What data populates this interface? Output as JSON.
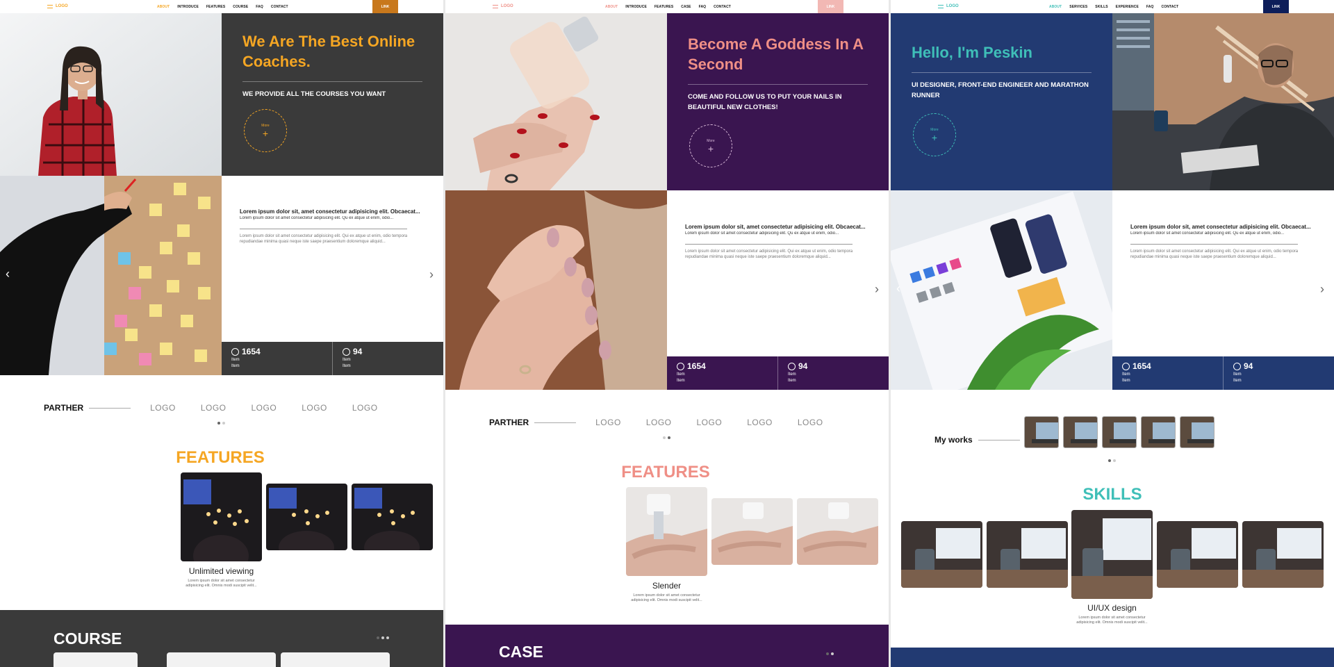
{
  "themes": [
    {
      "accent": "#f5a623",
      "dark": "#3a3a3a",
      "nav": {
        "logo": "LOGO",
        "items": [
          "ABOUT",
          "INTRODUCE",
          "FEATURES",
          "COURSE",
          "FAQ",
          "CONTACT"
        ],
        "link": "LINK"
      },
      "hero": {
        "title": "We Are The Best Online Coaches.",
        "subtitle": "WE PROVIDE ALL THE COURSES YOU WANT",
        "more": "More"
      },
      "text": {
        "title": "Lorem ipsum dolor sit, amet consectetur adipisicing elit. Obcaecat...",
        "line2": "Lorem ipsum dolor sit amet consectetur adipisicing elit. Qu ex atque ut enim, odio...",
        "body": "Lorem ipsum dolor sit amet consectetur adipisicing elit. Qui ex atque ut enim, odio tempora repudiandae minima quasi neque iste saepe praesentium doloremque aliquid..."
      },
      "stats": [
        {
          "num": "1654",
          "l1": "Item",
          "l2": "Item"
        },
        {
          "num": "94",
          "l1": "Item",
          "l2": "Item"
        }
      ],
      "partner": {
        "title": "PARTHER",
        "logos": [
          "LOGO",
          "LOGO",
          "LOGO",
          "LOGO",
          "LOGO"
        ]
      },
      "section": "FEATURES",
      "card": {
        "name": "Unlimited viewing",
        "desc": "Lorem ipsum dolor sit amet consectetur adipisicing elit. Omnis modi suscipit velit..."
      },
      "bottom": "COURSE"
    },
    {
      "accent": "#ef8f86",
      "dark": "#3a1550",
      "nav": {
        "logo": "LOGO",
        "items": [
          "ABOUT",
          "INTRODUCE",
          "FEATURES",
          "CASE",
          "FAQ",
          "CONTACT"
        ],
        "link": "LINK"
      },
      "hero": {
        "title": "Become A Goddess In A Second",
        "subtitle": "COME AND FOLLOW US TO PUT YOUR NAILS IN BEAUTIFUL NEW CLOTHES!",
        "more": "More"
      },
      "text": {
        "title": "Lorem ipsum dolor sit, amet consectetur adipisicing elit. Obcaecat...",
        "line2": "Lorem ipsum dolor sit amet consectetur adipisicing elit. Qu ex atque ut enim, odio...",
        "body": "Lorem ipsum dolor sit amet consectetur adipisicing elit. Qui ex atque ut enim, odio tempora repudiandae minima quasi neque iste saepe praesentium doloremque aliquid..."
      },
      "stats": [
        {
          "num": "1654",
          "l1": "Item",
          "l2": "Item"
        },
        {
          "num": "94",
          "l1": "Item",
          "l2": "Item"
        }
      ],
      "partner": {
        "title": "PARTHER",
        "logos": [
          "LOGO",
          "LOGO",
          "LOGO",
          "LOGO",
          "LOGO"
        ]
      },
      "section": "FEATURES",
      "card": {
        "name": "Slender",
        "desc": "Lorem ipsum dolor sit amet consectetur adipisicing elit. Omnis modi suscipit velit..."
      },
      "bottom": "CASE"
    },
    {
      "accent": "#3fbfb8",
      "dark": "#223a72",
      "nav": {
        "logo": "LOGO",
        "items": [
          "ABOUT",
          "SERVICES",
          "SKILLS",
          "EXPERIENCE",
          "FAQ",
          "CONTACT"
        ],
        "link": "LINK"
      },
      "hero": {
        "title": "Hello, I'm Peskin",
        "subtitle": "UI DESIGNER, FRONT-END ENGINEER AND MARATHON RUNNER",
        "more": "More"
      },
      "text": {
        "title": "Lorem ipsum dolor sit, amet consectetur adipisicing elit. Obcaecat...",
        "line2": "Lorem ipsum dolor sit amet consectetur adipisicing elit. Qu ex atque ut enim, odio...",
        "body": "Lorem ipsum dolor sit amet consectetur adipisicing elit. Qui ex atque ut enim, odio tempora repudiandae minima quasi neque iste saepe praesentium doloremque aliquid..."
      },
      "stats": [
        {
          "num": "1654",
          "l1": "Item",
          "l2": "Item"
        },
        {
          "num": "94",
          "l1": "Item",
          "l2": "Item"
        }
      ],
      "partner": {
        "title": "My works"
      },
      "section": "SKILLS",
      "card": {
        "name": "UI/UX design",
        "desc": "Lorem ipsum dolor sit amet consectetur adipisicing elit. Omnis modi suscipit velit..."
      },
      "bottom": ""
    }
  ]
}
